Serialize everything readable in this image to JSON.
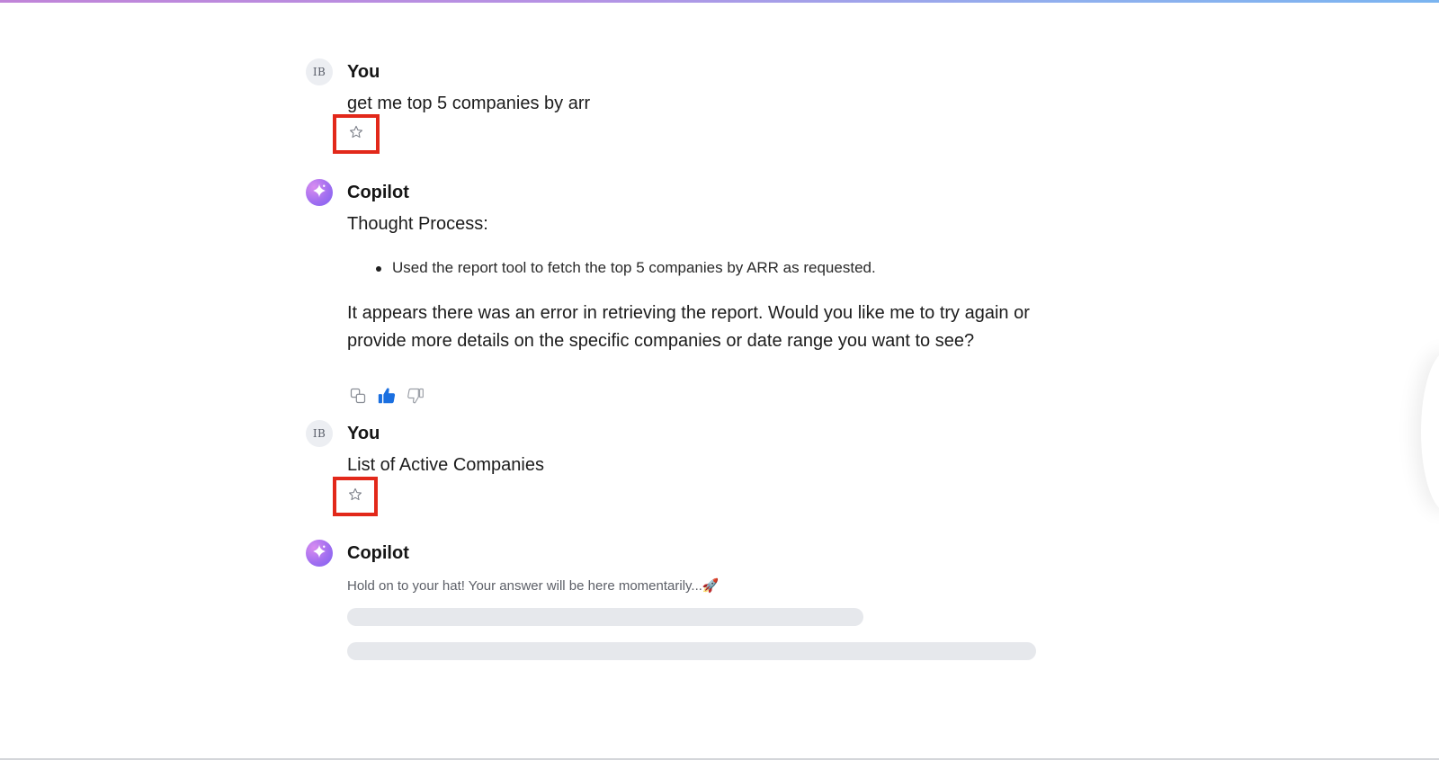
{
  "conversation": [
    {
      "role": "user",
      "sender": "You",
      "avatar_initials": "IB",
      "text": "get me top 5 companies by arr",
      "action_icon": "star-icon"
    },
    {
      "role": "assistant",
      "sender": "Copilot",
      "avatar_icon": "sparkle-icon",
      "thought_title": "Thought Process:",
      "thought_bullets": [
        "Used the report tool to fetch the top 5 companies by ARR as requested."
      ],
      "answer": "It appears there was an error in retrieving the report. Would you like me to try again or provide more details on the specific companies or date range you want to see?",
      "actions": [
        "copy-icon",
        "thumbs-up-icon",
        "thumbs-down-icon"
      ]
    },
    {
      "role": "user",
      "sender": "You",
      "avatar_initials": "IB",
      "text": "List of Active Companies",
      "action_icon": "star-icon"
    },
    {
      "role": "assistant",
      "sender": "Copilot",
      "avatar_icon": "sparkle-icon",
      "loading_text": "Hold on to your hat! Your answer will be here momentarily...🚀"
    }
  ],
  "colors": {
    "highlight_border": "#e2281a",
    "thumbs_up_active": "#1a6fe0",
    "skeleton": "#e6e8ec",
    "copilot_avatar": "#a26ff0"
  }
}
